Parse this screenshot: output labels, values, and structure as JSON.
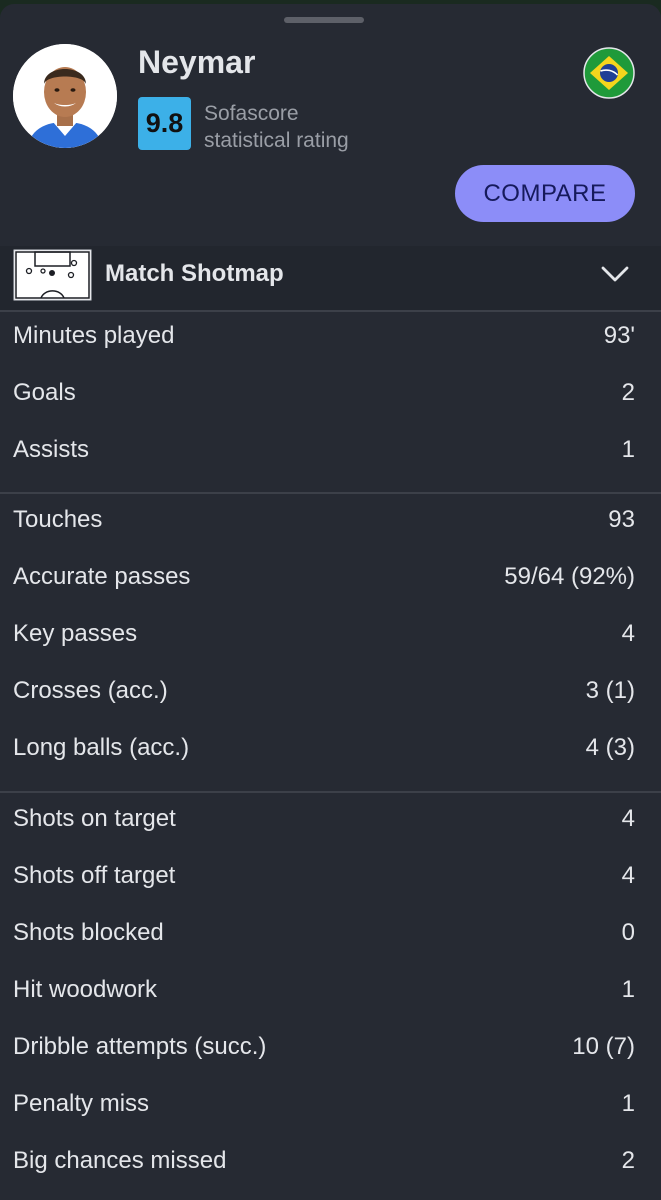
{
  "player": {
    "name": "Neymar",
    "rating": "9.8",
    "rating_caption_line1": "Sofascore",
    "rating_caption_line2": "statistical rating",
    "flag_icon": "brazil-flag-icon"
  },
  "actions": {
    "compare_label": "COMPARE"
  },
  "shotmap": {
    "label": "Match Shotmap",
    "icon": "pitch-icon"
  },
  "colors": {
    "background": "#262a33",
    "rating_badge": "#3cb0e8",
    "compare_button": "#8c8df8",
    "compare_text": "#161a5c",
    "text_primary": "#e4e6ea",
    "text_secondary": "#9a9ea6"
  },
  "stat_groups": [
    [
      {
        "label": "Minutes played",
        "value": "93'"
      },
      {
        "label": "Goals",
        "value": "2"
      },
      {
        "label": "Assists",
        "value": "1"
      }
    ],
    [
      {
        "label": "Touches",
        "value": "93"
      },
      {
        "label": "Accurate passes",
        "value": "59/64 (92%)"
      },
      {
        "label": "Key passes",
        "value": "4"
      },
      {
        "label": "Crosses (acc.)",
        "value": "3 (1)"
      },
      {
        "label": "Long balls (acc.)",
        "value": "4 (3)"
      }
    ],
    [
      {
        "label": "Shots on target",
        "value": "4"
      },
      {
        "label": "Shots off target",
        "value": "4"
      },
      {
        "label": "Shots blocked",
        "value": "0"
      },
      {
        "label": "Hit woodwork",
        "value": "1"
      },
      {
        "label": "Dribble attempts (succ.)",
        "value": "10 (7)"
      },
      {
        "label": "Penalty miss",
        "value": "1"
      },
      {
        "label": "Big chances missed",
        "value": "2"
      }
    ]
  ]
}
